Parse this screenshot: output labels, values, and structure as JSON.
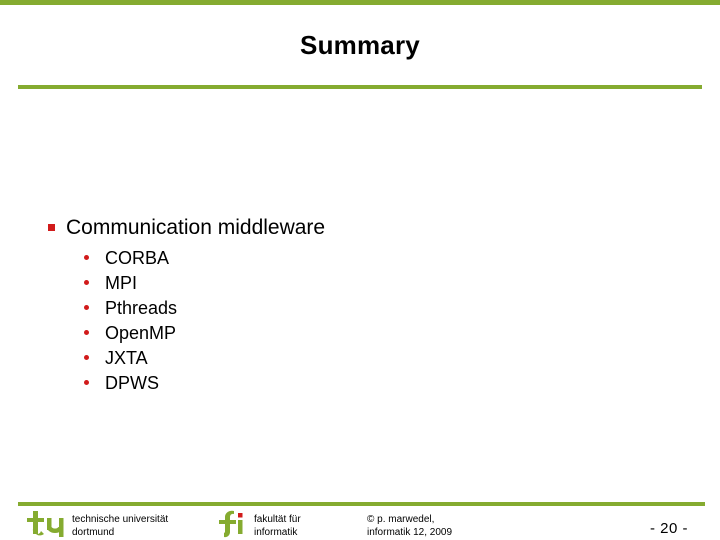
{
  "theme": {
    "accent_green": "#85ab30",
    "bullet_red": "#d11b1b",
    "text_black": "#000000",
    "background": "#ffffff"
  },
  "slide": {
    "title": "Summary"
  },
  "content": {
    "bullets": [
      {
        "marker": "square-bullet-icon",
        "label": "Communication middleware",
        "children": [
          {
            "marker": "dot-bullet-icon",
            "label": "CORBA"
          },
          {
            "marker": "dot-bullet-icon",
            "label": "MPI"
          },
          {
            "marker": "dot-bullet-icon",
            "label": "Pthreads"
          },
          {
            "marker": "dot-bullet-icon",
            "label": "OpenMP"
          },
          {
            "marker": "dot-bullet-icon",
            "label": "JXTA"
          },
          {
            "marker": "dot-bullet-icon",
            "label": "DPWS"
          }
        ]
      }
    ]
  },
  "footer": {
    "university": {
      "logo": "tu-dortmund-logo",
      "line1": "technische universität",
      "line2": "dortmund"
    },
    "faculty": {
      "logo": "fakultaet-informatik-logo",
      "line1": "fakultät für",
      "line2": "informatik"
    },
    "copyright": {
      "line1": "© p. marwedel,",
      "line2": "informatik 12,  2009"
    },
    "page_number": "-  20 -"
  }
}
